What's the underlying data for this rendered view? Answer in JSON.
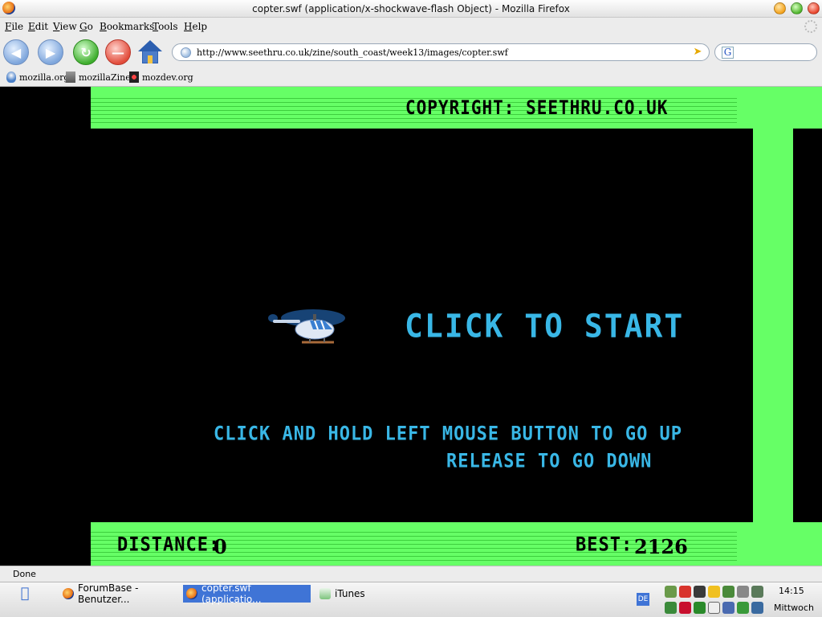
{
  "window": {
    "title": "copter.swf (application/x-shockwave-flash Object) - Mozilla Firefox"
  },
  "menu": [
    "File",
    "Edit",
    "View",
    "Go",
    "Bookmarks",
    "Tools",
    "Help"
  ],
  "nav": {
    "url": "http://www.seethru.co.uk/zine/south_coast/week13/images/copter.swf",
    "search_value": ""
  },
  "bookmarks": [
    "mozilla.org",
    "mozillaZine",
    "mozdev.org"
  ],
  "game": {
    "copyright": "COPYRIGHT: SEETHRU.CO.UK",
    "start_prompt": "CLICK TO START",
    "instruction_up": "CLICK AND HOLD LEFT MOUSE BUTTON TO GO UP",
    "instruction_down": "RELEASE TO GO DOWN",
    "distance_label": "DISTANCE:",
    "distance_value": "0",
    "best_label": "BEST:",
    "best_value": "2126",
    "colors": {
      "wall": "#66ff66",
      "text_cyan": "#39b7e6",
      "background": "#000000"
    }
  },
  "status": {
    "text": "Done"
  },
  "taskbar": {
    "tasks": [
      "ForumBase - Benutzer...",
      "copter.swf (applicatio...",
      "iTunes"
    ],
    "language": "DE",
    "time": "14:15",
    "day": "Mittwoch"
  }
}
